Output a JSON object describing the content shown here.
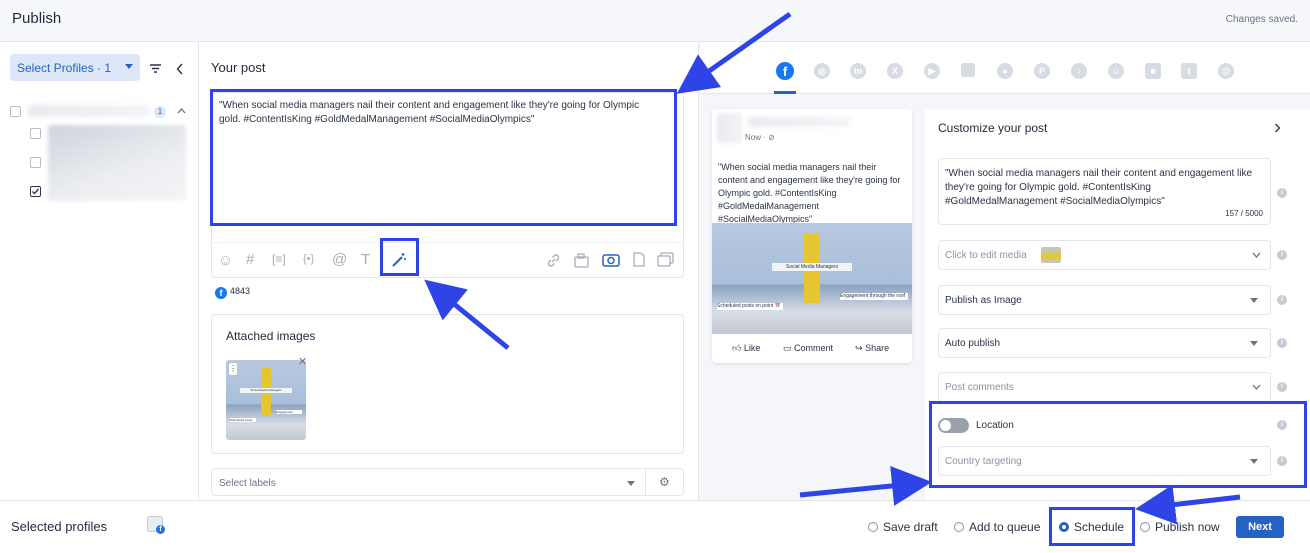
{
  "header": {
    "title": "Publish",
    "status": "Changes saved."
  },
  "sidebar": {
    "select_profiles": "Select Profiles · 1",
    "group_count": "1"
  },
  "editor": {
    "heading": "Your post",
    "text": "\"When social media managers nail their content and engagement like they're going for Olympic gold. #ContentIsKing #GoldMedalManagement #SocialMediaOlympics\"",
    "fb_count": "4843",
    "attached_heading": "Attached images",
    "labels_placeholder": "Select labels"
  },
  "image": {
    "banner": "Social Media Managers",
    "left_caption": "Scheduled posts on point 📅",
    "right_caption": "Engagement through the roof 🚀"
  },
  "preview": {
    "time": "Now · ⊘",
    "text": "\"When social media managers nail their content and engagement like they're going for Olympic gold. #ContentIsKing #GoldMedalManagement #SocialMediaOlympics\"",
    "like": "Like",
    "comment": "Comment",
    "share": "Share"
  },
  "customize": {
    "heading": "Customize your post",
    "text": "\"When social media managers nail their content and engagement like they're going for Olympic gold. #ContentIsKing #GoldMedalManagement #SocialMediaOlympics\"",
    "char_count": "157 / 5000",
    "media": "Click to edit media",
    "publish_as": "Publish as Image",
    "auto_publish": "Auto publish",
    "post_comments": "Post comments",
    "location": "Location",
    "country": "Country targeting"
  },
  "footer": {
    "selected_profiles": "Selected profiles",
    "save_draft": "Save draft",
    "add_to_queue": "Add to queue",
    "schedule": "Schedule",
    "publish_now": "Publish now",
    "next": "Next"
  },
  "colors": {
    "accent": "#2562c4",
    "annotation": "#2f44e6",
    "facebook": "#1877f2"
  }
}
